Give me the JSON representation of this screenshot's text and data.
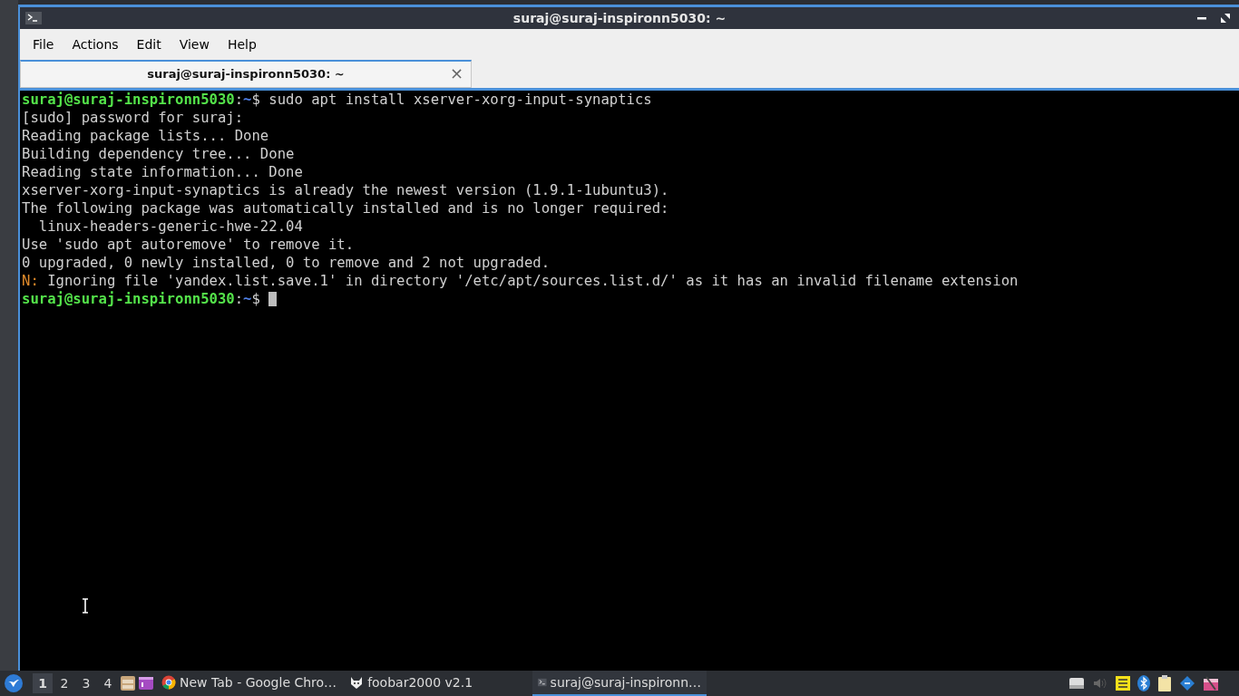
{
  "window": {
    "title": "suraj@suraj-inspironn5030: ~"
  },
  "menu": [
    "File",
    "Actions",
    "Edit",
    "View",
    "Help"
  ],
  "tabs": [
    {
      "label": "suraj@suraj-inspironn5030: ~",
      "close": "×",
      "selected": true
    }
  ],
  "terminal": {
    "lines": [
      [
        {
          "kind": "user",
          "text": "suraj@suraj-inspironn5030"
        },
        {
          "kind": "plain",
          "text": ":"
        },
        {
          "kind": "path",
          "text": "~"
        },
        {
          "kind": "plain",
          "text": "$ sudo apt install xserver-xorg-input-synaptics"
        }
      ],
      [
        {
          "kind": "plain",
          "text": "[sudo] password for suraj:"
        }
      ],
      [
        {
          "kind": "plain",
          "text": "Reading package lists... Done"
        }
      ],
      [
        {
          "kind": "plain",
          "text": "Building dependency tree... Done"
        }
      ],
      [
        {
          "kind": "plain",
          "text": "Reading state information... Done"
        }
      ],
      [
        {
          "kind": "plain",
          "text": "xserver-xorg-input-synaptics is already the newest version (1.9.1-1ubuntu3)."
        }
      ],
      [
        {
          "kind": "plain",
          "text": "The following package was automatically installed and is no longer required:"
        }
      ],
      [
        {
          "kind": "plain",
          "text": "  linux-headers-generic-hwe-22.04"
        }
      ],
      [
        {
          "kind": "plain",
          "text": "Use 'sudo apt autoremove' to remove it."
        }
      ],
      [
        {
          "kind": "plain",
          "text": "0 upgraded, 0 newly installed, 0 to remove and 2 not upgraded."
        }
      ],
      [
        {
          "kind": "warn",
          "text": "N:"
        },
        {
          "kind": "plain",
          "text": " Ignoring file 'yandex.list.save.1' in directory '/etc/apt/sources.list.d/' as it has an invalid filename extension"
        }
      ],
      [
        {
          "kind": "user",
          "text": "suraj@suraj-inspironn5030"
        },
        {
          "kind": "plain",
          "text": ":"
        },
        {
          "kind": "path",
          "text": "~"
        },
        {
          "kind": "plain",
          "text": "$ "
        }
      ]
    ],
    "cursor": true
  },
  "taskbar": {
    "workspaces": [
      {
        "label": "1",
        "selected": true
      },
      {
        "label": "2",
        "selected": false
      },
      {
        "label": "3",
        "selected": false
      },
      {
        "label": "4",
        "selected": false
      }
    ],
    "tasks": [
      {
        "kind": "chrome",
        "label": "New Tab - Google Chro…",
        "selected": false
      },
      {
        "kind": "foobar",
        "label": "foobar2000 v2.1",
        "selected": false
      },
      {
        "kind": "terminal",
        "label": "suraj@suraj-inspironn…",
        "selected": true
      }
    ]
  }
}
